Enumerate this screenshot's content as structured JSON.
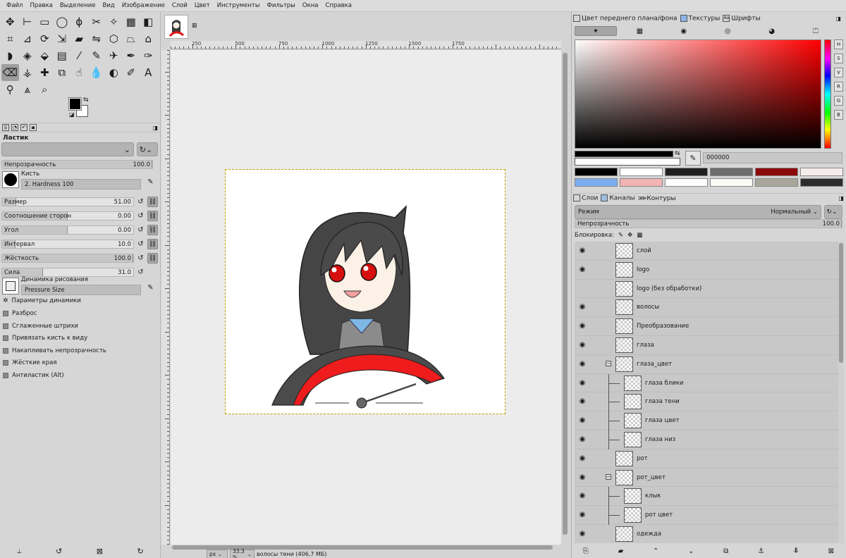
{
  "menubar": [
    "Файл",
    "Правка",
    "Выделение",
    "Вид",
    "Изображение",
    "Слой",
    "Цвет",
    "Инструменты",
    "Фильтры",
    "Окна",
    "Справка"
  ],
  "toolbox": {
    "tools": [
      {
        "icon": "move-icon",
        "glyph": "✥"
      },
      {
        "icon": "align-icon",
        "glyph": "⊢"
      },
      {
        "icon": "rect-select-icon",
        "glyph": "▭"
      },
      {
        "icon": "ellipse-select-icon",
        "glyph": "◯"
      },
      {
        "icon": "lasso-icon",
        "glyph": "ϕ"
      },
      {
        "icon": "scissors-icon",
        "glyph": "✂"
      },
      {
        "icon": "fuzzy-select-icon",
        "glyph": "✧"
      },
      {
        "icon": "select-by-color-icon",
        "glyph": "▦"
      },
      {
        "icon": "foreground-select-icon",
        "glyph": "◧"
      },
      {
        "icon": "crop-icon",
        "glyph": "⌗"
      },
      {
        "icon": "unified-transform-icon",
        "glyph": "⊿"
      },
      {
        "icon": "rotate-icon",
        "glyph": "⟳"
      },
      {
        "icon": "scale-icon",
        "glyph": "⇲"
      },
      {
        "icon": "shear-icon",
        "glyph": "▰"
      },
      {
        "icon": "flip-icon",
        "glyph": "⇋"
      },
      {
        "icon": "3d-transform-icon",
        "glyph": "⬡"
      },
      {
        "icon": "perspective-icon",
        "glyph": "⏢"
      },
      {
        "icon": "cage-icon",
        "glyph": "⌂"
      },
      {
        "icon": "warp-icon",
        "glyph": "◗"
      },
      {
        "icon": "handle-transform-icon",
        "glyph": "◈"
      },
      {
        "icon": "bucket-fill-icon",
        "glyph": "⬙"
      },
      {
        "icon": "gradient-icon",
        "glyph": "▤"
      },
      {
        "icon": "paintbrush-icon",
        "glyph": "⁄"
      },
      {
        "icon": "pencil-icon",
        "glyph": "✎"
      },
      {
        "icon": "airbrush-icon",
        "glyph": "✈"
      },
      {
        "icon": "ink-icon",
        "glyph": "✒"
      },
      {
        "icon": "mypaint-brush-icon",
        "glyph": "✑"
      },
      {
        "icon": "eraser-icon",
        "glyph": "⌫"
      },
      {
        "icon": "clone-icon",
        "glyph": "⚶"
      },
      {
        "icon": "heal-icon",
        "glyph": "✚"
      },
      {
        "icon": "perspective-clone-icon",
        "glyph": "⧉"
      },
      {
        "icon": "smudge-icon",
        "glyph": "☝"
      },
      {
        "icon": "blur-icon",
        "glyph": "💧"
      },
      {
        "icon": "dodge-burn-icon",
        "glyph": "◐"
      },
      {
        "icon": "paths-icon",
        "glyph": "✐"
      },
      {
        "icon": "text-icon",
        "glyph": "A"
      },
      {
        "icon": "color-picker-icon",
        "glyph": "⚲"
      },
      {
        "icon": "measure-icon",
        "glyph": "⩓"
      },
      {
        "icon": "zoom-icon",
        "glyph": "⌕"
      }
    ],
    "active_tool_index": 27,
    "tool_options_title": "Ластик",
    "opacity_label": "Непрозрачность",
    "opacity_value": "100.0",
    "brush_label": "Кисть",
    "brush_name": "2. Hardness 100",
    "sliders": [
      {
        "label": "Размер",
        "value": "51.00",
        "fraction": 0.11
      },
      {
        "label": "Соотношение сторон",
        "value": "0.00",
        "fraction": 0.5
      },
      {
        "label": "Угол",
        "value": "0.00",
        "fraction": 0.5
      },
      {
        "label": "Интервал",
        "value": "10.0",
        "fraction": 0.1
      },
      {
        "label": "Жёсткость",
        "value": "100.0",
        "fraction": 1.0
      },
      {
        "label": "Сила",
        "value": "31.0",
        "fraction": 0.31
      }
    ],
    "dynamics_label": "Динамика рисования",
    "dynamics_name": "Pressure Size",
    "dynamics_options": "Параметры динамики",
    "checks": [
      "Разброс",
      "Сглаженные штрихи",
      "Привязать кисть к виду",
      "Накапливать непрозрачность",
      "Жёсткие края",
      "Антиластик (Alt)"
    ]
  },
  "canvas": {
    "ruler_labels": [
      "250",
      "500",
      "750",
      "1000",
      "1250",
      "1500",
      "1750"
    ],
    "status_unit": "px",
    "status_zoom": "33.3 %",
    "status_text": "волосы тени (406,7 МБ)"
  },
  "colors": {
    "tab_fg_bg": "Цвет переднего плана/фона",
    "tab_textures": "Текстуры",
    "tab_fonts": "Шрифты",
    "hex": "000000",
    "fg": "#000000",
    "bg": "#ffffff",
    "history": [
      "#000000",
      "#ffffff",
      "#202020",
      "#6d6d6d",
      "#8b0a0a",
      "#f7ecec",
      "#7aaef0",
      "#f3b4b4",
      "#ffffff",
      "#fbfbf5",
      "#a9a69b",
      "#2d2d2d"
    ]
  },
  "layers": {
    "tab_layers": "Слои",
    "tab_channels": "Каналы",
    "tab_paths": "Контуры",
    "mode_label": "Режим",
    "mode_value": "Нормальный",
    "opacity_label": "Непрозрачность",
    "opacity_value": "100.0",
    "lock_label": "Блокировка:",
    "items": [
      {
        "name": "слой",
        "visible": true,
        "indent": 0,
        "group": false
      },
      {
        "name": "logo",
        "visible": true,
        "indent": 0,
        "group": false
      },
      {
        "name": "logo (без обработки)",
        "visible": false,
        "indent": 0,
        "group": false
      },
      {
        "name": "волосы",
        "visible": true,
        "indent": 0,
        "group": false
      },
      {
        "name": "Преобразование",
        "visible": true,
        "indent": 0,
        "group": false
      },
      {
        "name": "глаза",
        "visible": true,
        "indent": 0,
        "group": false
      },
      {
        "name": "глаза_цвет",
        "visible": true,
        "indent": 0,
        "group": true
      },
      {
        "name": "глаза блики",
        "visible": true,
        "indent": 1,
        "group": false
      },
      {
        "name": "глаза тени",
        "visible": true,
        "indent": 1,
        "group": false
      },
      {
        "name": "глаза цвет",
        "visible": true,
        "indent": 1,
        "group": false
      },
      {
        "name": "глаза низ",
        "visible": true,
        "indent": 1,
        "group": false
      },
      {
        "name": "рот",
        "visible": true,
        "indent": 0,
        "group": false
      },
      {
        "name": "рот_цвет",
        "visible": true,
        "indent": 0,
        "group": true
      },
      {
        "name": "клык",
        "visible": true,
        "indent": 1,
        "group": false
      },
      {
        "name": "рот цвет",
        "visible": true,
        "indent": 1,
        "group": false
      },
      {
        "name": "одежда",
        "visible": true,
        "indent": 0,
        "group": false
      }
    ]
  }
}
